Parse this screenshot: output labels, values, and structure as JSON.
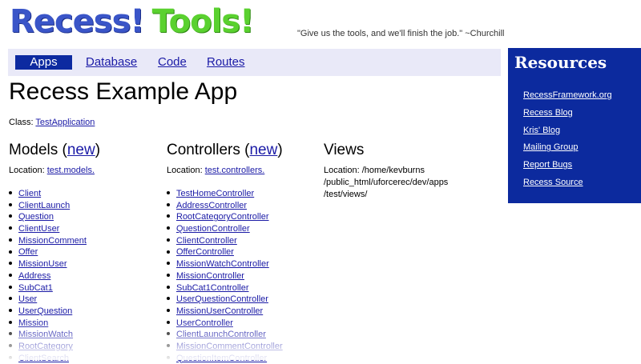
{
  "logo": {
    "recess": "Recess!",
    "tools": "Tools!"
  },
  "quote": "\"Give us the tools, and we'll finish the job.\" ~Churchill",
  "nav": [
    "Apps",
    "Database",
    "Code",
    "Routes"
  ],
  "page_title": "Recess Example App",
  "class": {
    "label": "Class:",
    "value": "TestApplication"
  },
  "models": {
    "heading": "Models (",
    "new_label": "new",
    "heading_end": ")",
    "location_label": "Location:",
    "location_value": "test.models.",
    "items": [
      "Client",
      "ClientLaunch",
      "Question",
      "ClientUser",
      "MissionComment",
      "Offer",
      "MissionUser",
      "Address",
      "SubCat1",
      "User",
      "UserQuestion",
      "Mission",
      "MissionWatch",
      "RootCategory",
      "ClientSearch"
    ]
  },
  "controllers": {
    "heading": "Controllers (",
    "new_label": "new",
    "heading_end": ")",
    "location_label": "Location:",
    "location_value": "test.controllers.",
    "items": [
      "TestHomeController",
      "AddressController",
      "RootCategoryController",
      "QuestionController",
      "ClientController",
      "OfferController",
      "MissionWatchController",
      "MissionController",
      "SubCat1Controller",
      "UserQuestionController",
      "MissionUserController",
      "UserController",
      "ClientLaunchController",
      "MissionCommentController",
      "QuestionItemController"
    ]
  },
  "views": {
    "heading": "Views",
    "location_line1": "Location: /home/kevburns",
    "location_line2": "/public_html/uforcerec/dev/apps",
    "location_line3": "/test/views/"
  },
  "resources": {
    "heading": "Resources",
    "links": [
      "RecessFramework.org",
      "Recess Blog",
      "Kris' Blog",
      "Mailing Group",
      "Report Bugs",
      "Recess Source"
    ]
  },
  "colors": {
    "nav_active": "#0d2aa0",
    "sidebar": "#0c2a9e",
    "logo_blue": "#3a55c8",
    "logo_green": "#5ad12f"
  }
}
